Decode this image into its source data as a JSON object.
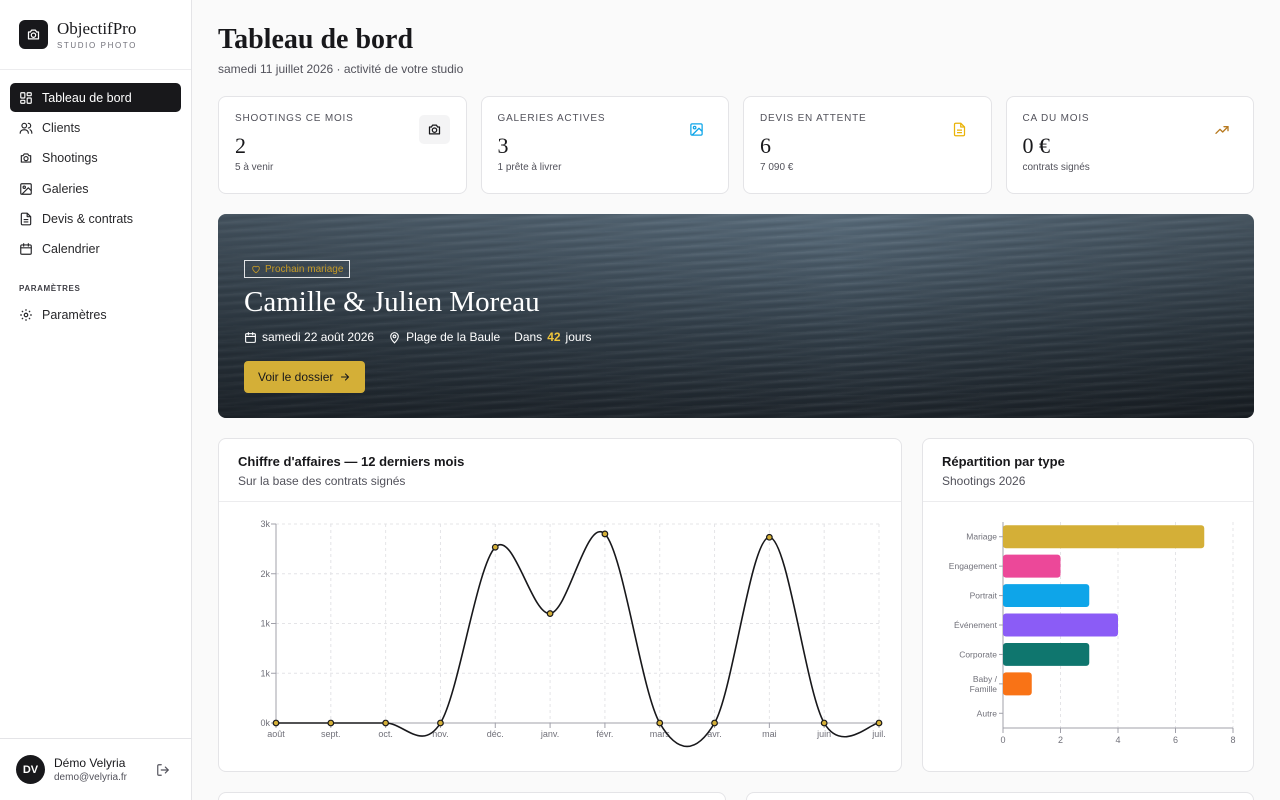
{
  "brand": {
    "name": "ObjectifPro",
    "subtitle": "STUDIO PHOTO"
  },
  "sidebar": {
    "items": [
      {
        "label": "Tableau de bord",
        "icon": "dashboard-icon",
        "active": true
      },
      {
        "label": "Clients",
        "icon": "users-icon"
      },
      {
        "label": "Shootings",
        "icon": "camera-icon"
      },
      {
        "label": "Galeries",
        "icon": "image-icon"
      },
      {
        "label": "Devis & contrats",
        "icon": "document-icon"
      },
      {
        "label": "Calendrier",
        "icon": "calendar-icon"
      }
    ],
    "section_label": "PARAMÈTRES",
    "settings_item": {
      "label": "Paramètres",
      "icon": "gear-icon"
    }
  },
  "user": {
    "initials": "DV",
    "name": "Démo Velyria",
    "email": "demo@velyria.fr"
  },
  "header": {
    "title": "Tableau de bord",
    "subtitle": "samedi 11 juillet 2026 · activité de votre studio"
  },
  "kpis": [
    {
      "label": "SHOOTINGS CE MOIS",
      "value": "2",
      "note": "5 à venir",
      "icon": "camera-icon",
      "color": "#18181b"
    },
    {
      "label": "GALERIES ACTIVES",
      "value": "3",
      "note": "1 prête à livrer",
      "icon": "image-icon",
      "color": "#0ea5e9"
    },
    {
      "label": "DEVIS EN ATTENTE",
      "value": "6",
      "note": "7 090 €",
      "icon": "document-icon",
      "color": "#eab308"
    },
    {
      "label": "CA DU MOIS",
      "value": "0 €",
      "note": "contrats signés",
      "icon": "trending-up-icon",
      "color": "#b7791f"
    }
  ],
  "hero": {
    "tag": "Prochain mariage",
    "title": "Camille & Julien Moreau",
    "date": "samedi 22 août 2026",
    "location": "Plage de la Baule",
    "days_prefix": "Dans",
    "days": "42",
    "days_suffix": "jours",
    "button": "Voir le dossier"
  },
  "revenue_card": {
    "title": "Chiffre d'affaires — 12 derniers mois",
    "subtitle": "Sur la base des contrats signés"
  },
  "type_card": {
    "title": "Répartition par type",
    "subtitle": "Shootings 2026"
  },
  "chart_data": [
    {
      "type": "line",
      "title": "Chiffre d'affaires — 12 derniers mois",
      "categories": [
        "août",
        "sept.",
        "oct.",
        "nov.",
        "déc.",
        "janv.",
        "févr.",
        "mars",
        "avr.",
        "mai",
        "juin",
        "juil."
      ],
      "values": [
        0,
        0,
        0,
        0,
        2650,
        1650,
        2850,
        0,
        0,
        2800,
        0,
        0
      ],
      "y_ticks": [
        0,
        750,
        1500,
        2250,
        3000
      ],
      "y_tick_labels": [
        "0k",
        "1k",
        "1k",
        "2k",
        "3k"
      ],
      "ylim": [
        0,
        3000
      ],
      "grid": true,
      "line_color": "#18181b",
      "point_fill": "#d4af37"
    },
    {
      "type": "bar",
      "orientation": "horizontal",
      "title": "Répartition par type",
      "categories": [
        "Mariage",
        "Engagement",
        "Portrait",
        "Événement",
        "Corporate",
        "Baby / Famille",
        "Autre"
      ],
      "values": [
        7,
        2,
        3,
        4,
        3,
        1,
        0
      ],
      "colors": [
        "#d4af37",
        "#ec4899",
        "#0ea5e9",
        "#8b5cf6",
        "#0f766e",
        "#f97316",
        "#a1a1aa"
      ],
      "x_ticks": [
        0,
        2,
        4,
        6,
        8
      ],
      "xlim": [
        0,
        8
      ],
      "grid": true
    }
  ]
}
